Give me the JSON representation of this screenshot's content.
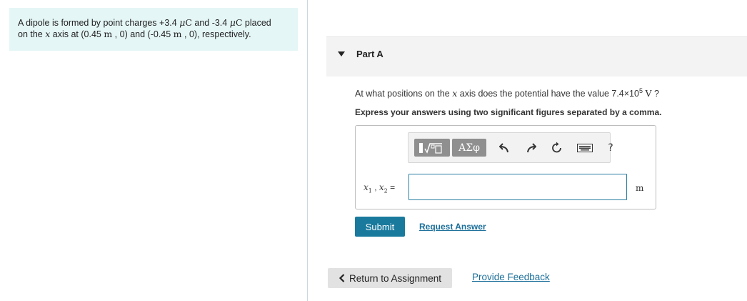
{
  "problem": {
    "line1_a": "A dipole is formed by point charges +3.4 ",
    "q1_unit": "μC",
    "line1_b": " and -3.4 ",
    "q2_unit": "μC",
    "line1_c": " placed",
    "line2_a": "on the ",
    "axis_var": "x",
    "line2_b": " axis at (0.45 ",
    "pos_unit_1": "m",
    "line2_c": " , 0) and (-0.45 ",
    "pos_unit_2": "m",
    "line2_d": " , 0), respectively."
  },
  "part": {
    "title": "Part A"
  },
  "question": {
    "text_a": "At what positions on the ",
    "axis_var": "x",
    "text_b": " axis does the potential have the value 7.4×10",
    "exponent": "5",
    "unit": "V",
    "text_c": " ?",
    "instruction": "Express your answers using two significant figures separated by a comma."
  },
  "toolbar": {
    "templates_icon": "sqrt-template-icon",
    "symbols_label": "ΑΣφ",
    "undo_icon": "undo-icon",
    "redo_icon": "redo-icon",
    "reset_icon": "reset-icon",
    "keyboard_icon": "keyboard-icon",
    "help_label": "?"
  },
  "answer": {
    "var1": "x",
    "sub1": "1",
    "sep": " , ",
    "var2": "x",
    "sub2": "2",
    "equals": " =",
    "value": "",
    "unit": "m"
  },
  "actions": {
    "submit_label": "Submit",
    "request_answer_label": "Request Answer",
    "return_label": "Return to Assignment",
    "feedback_label": "Provide Feedback"
  },
  "colors": {
    "problem_bg": "#e5f6f6",
    "submit_bg": "#1a7a9e",
    "link": "#1a6e9a",
    "input_border": "#2a7fa2"
  }
}
